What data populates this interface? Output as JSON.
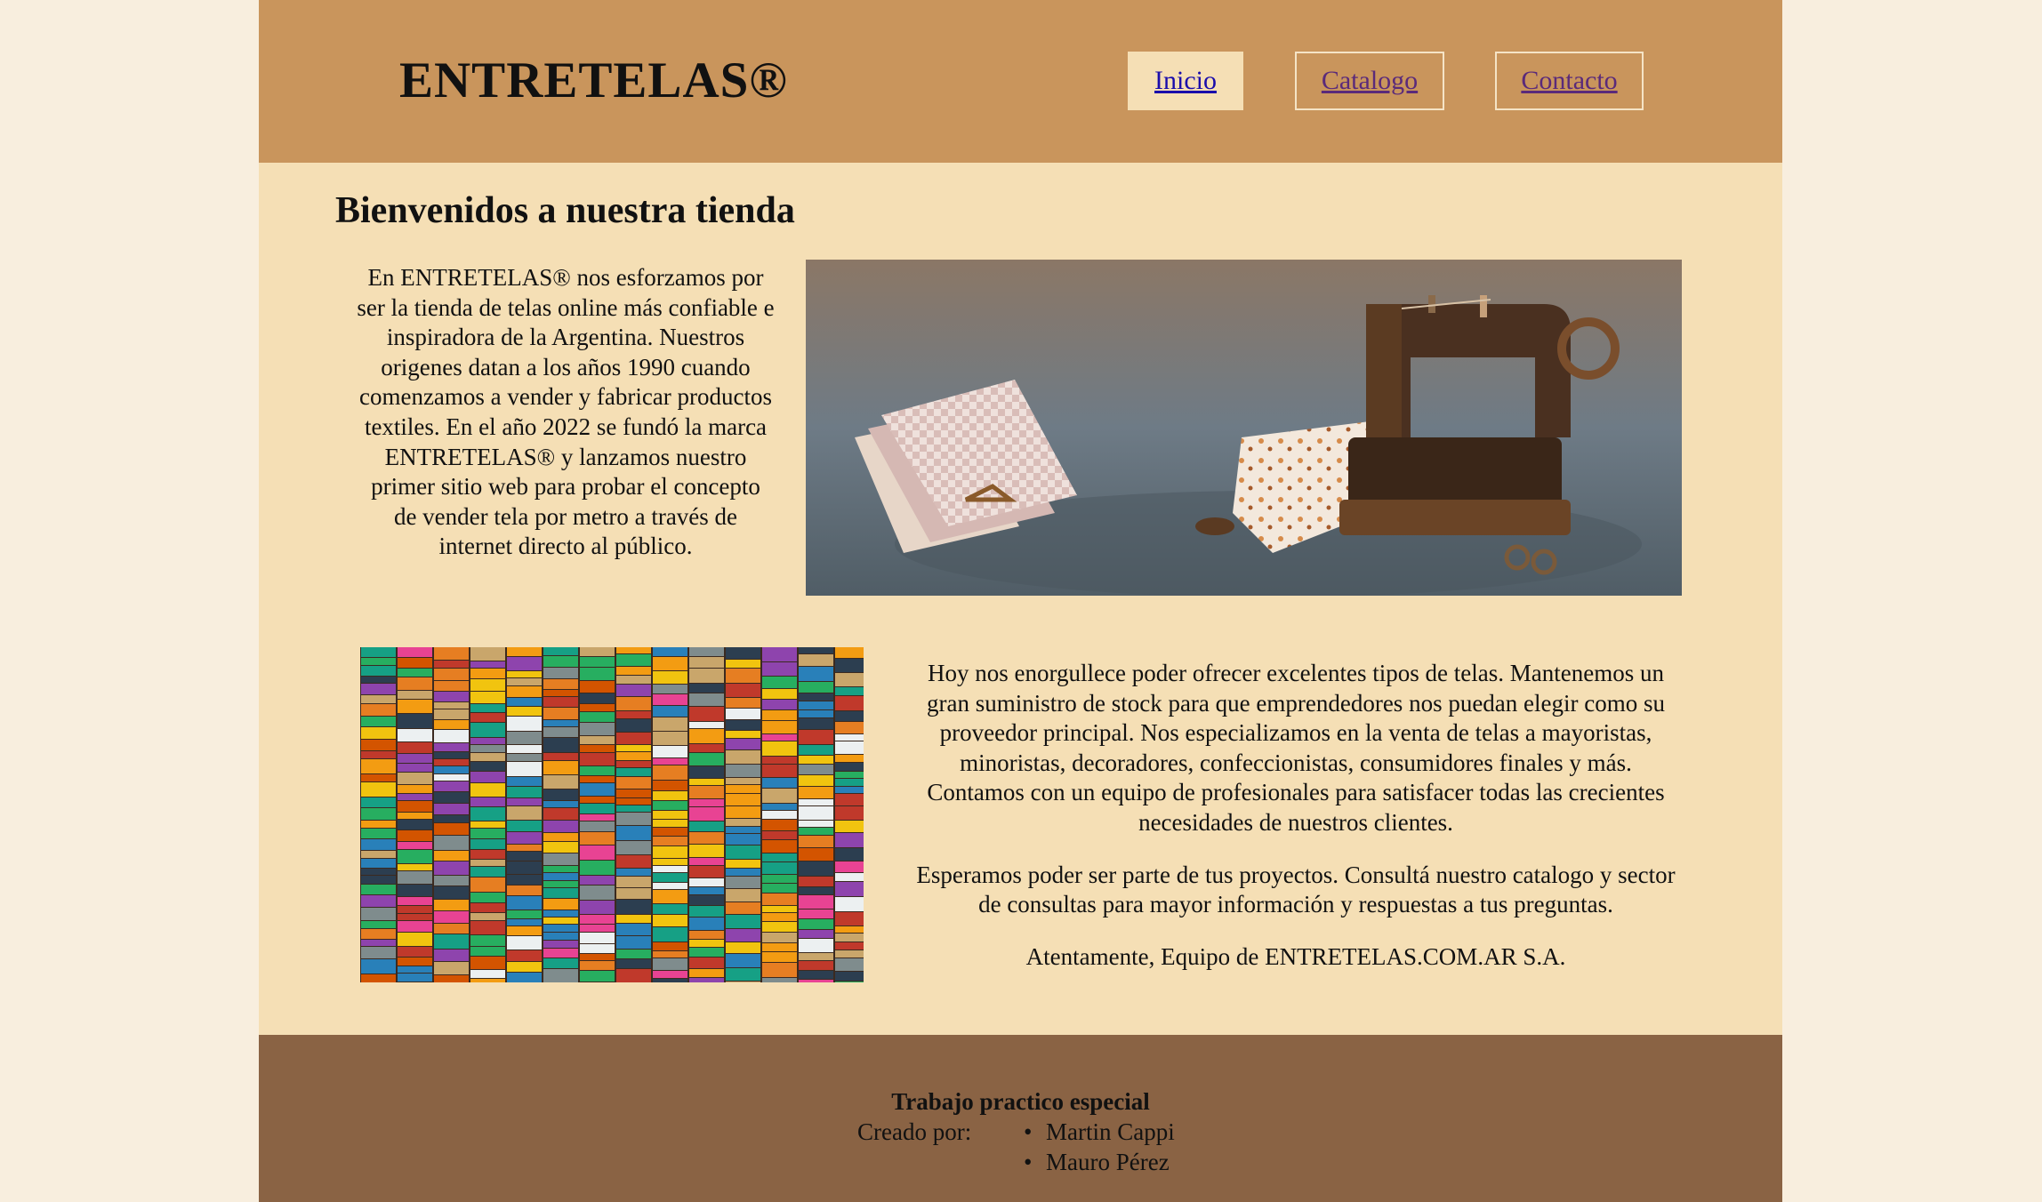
{
  "header": {
    "brand": "ENTRETELAS®",
    "nav": [
      {
        "label": "Inicio"
      },
      {
        "label": "Catalogo"
      },
      {
        "label": "Contacto"
      }
    ]
  },
  "main": {
    "title": "Bienvenidos a nuestra tienda",
    "intro": "En ENTRETELAS® nos esforzamos por ser la tienda de telas online más confiable e inspiradora de la Argentina. Nuestros origenes datan a los años 1990 cuando comenzamos a vender y fabricar productos textiles. En el año 2022 se fundó la marca ENTRETELAS® y lanzamos nuestro primer sitio web para probar el concepto de vender tela por metro a través de internet directo al público.",
    "paragraphs": [
      "Hoy nos enorgullece poder ofrecer excelentes tipos de telas. Mantenemos un gran suministro de stock para que emprendedores nos puedan elegir como su proveedor principal. Nos especializamos en la venta de telas a mayoristas, minoristas, decoradores, confeccionistas, consumidores finales y más. Contamos con un equipo de profesionales para satisfacer todas las crecientes necesidades de nuestros clientes.",
      "Esperamos poder ser parte de tus proyectos. Consultá nuestro catalogo y sector de consultas para mayor información y respuestas a tus preguntas.",
      "Atentamente, Equipo de ENTRETELAS.COM.AR S.A."
    ]
  },
  "footer": {
    "title": "Trabajo practico especial",
    "created_by": "Creado por:",
    "authors": [
      "Martin Cappi",
      "Mauro Pérez"
    ]
  },
  "colors": {
    "header_bg": "#c9955c",
    "content_bg": "#f5dfb5",
    "footer_bg": "#8a6344",
    "page_bg": "#f8eede"
  }
}
